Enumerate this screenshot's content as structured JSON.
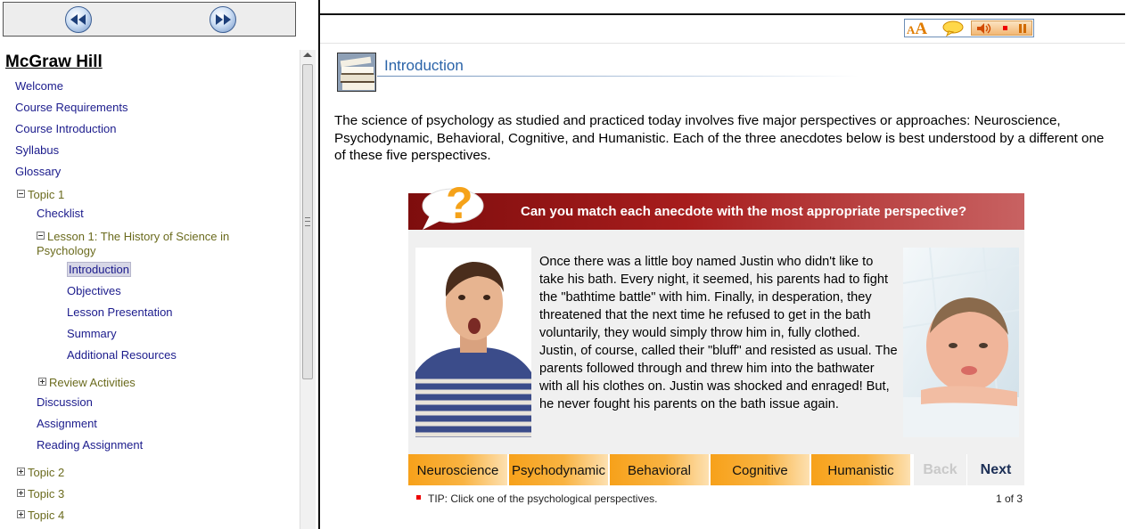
{
  "sidebar": {
    "brand": "McGraw Hill",
    "items": {
      "welcome": "Welcome",
      "course_requirements": "Course Requirements",
      "course_introduction": "Course Introduction",
      "syllabus": "Syllabus",
      "glossary": "Glossary",
      "topic1": "Topic 1",
      "checklist": "Checklist",
      "lesson1": "Lesson 1: The History of Science in Psychology",
      "introduction": "Introduction",
      "objectives": "Objectives",
      "lesson_presentation": "Lesson Presentation",
      "summary": "Summary",
      "additional_resources": "Additional Resources",
      "review_activities": "Review Activities",
      "discussion": "Discussion",
      "assignment": "Assignment",
      "reading_assignment": "Reading Assignment",
      "topic2": "Topic 2",
      "topic3": "Topic 3",
      "topic4": "Topic 4"
    },
    "selected": "Introduction"
  },
  "header": {
    "section_title": "Introduction",
    "font_size_icon": {
      "small": "A",
      "large": "A"
    }
  },
  "main": {
    "intro_text": "The science of psychology as studied and practiced today involves five major perspectives or approaches: Neuroscience, Psychodynamic, Behavioral, Cognitive, and Humanistic. Each of the three anecdotes below is best understood by a different one of these five perspectives."
  },
  "activity": {
    "question_mark": "?",
    "question": "Can you match each anecdote with the most appropriate perspective?",
    "anecdote": "Once there was a little boy named Justin who didn't like to take his bath. Every night, it seemed, his parents had to fight the \"bathtime battle\" with him. Finally, in desperation, they threatened that the next time he refused to get in the bath voluntarily, they would simply throw him in, fully clothed.  Justin, of course, called their \"bluff\" and resisted as usual. The parents followed through and threw him into the bathwater with all his clothes on.  Justin was shocked and enraged! But, he never fought his parents on the bath issue again.",
    "choices": [
      "Neuroscience",
      "Psychodynamic",
      "Behavioral",
      "Cognitive",
      "Humanistic"
    ],
    "back_label": "Back",
    "next_label": "Next",
    "tip": "TIP: Click one of the psychological perspectives.",
    "page_indicator": "1 of 3"
  },
  "colors": {
    "accent_blue": "#2a63a8",
    "link_blue": "#1b1b8c",
    "tree_olive": "#6b6b1e",
    "question_red": "#a71d1d",
    "choice_orange": "#f7a11a"
  },
  "icons": [
    "rewind-icon",
    "fast-forward-icon",
    "font-size-icon",
    "speech-bubble-icon",
    "speaker-icon",
    "stop-icon",
    "pause-icon",
    "books-icon",
    "question-bubble-icon"
  ]
}
